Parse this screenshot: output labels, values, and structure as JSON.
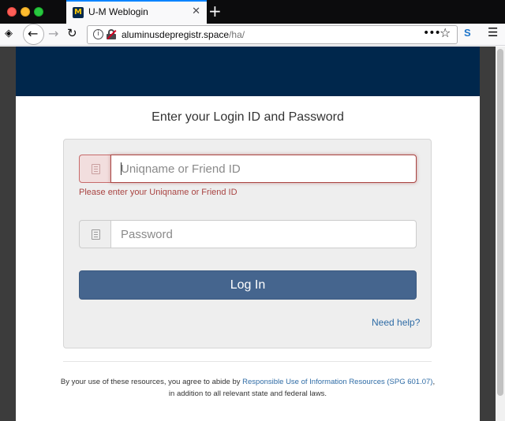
{
  "browser": {
    "tab_title": "U-M Weblogin",
    "tab_close": "✕",
    "new_tab": "+",
    "url_domain": "aluminusdepregistr.space",
    "url_path": "/ha/",
    "page_actions": "•••",
    "extension_label": "S"
  },
  "login": {
    "heading": "Enter your Login ID and Password",
    "username_placeholder": "Uniqname or Friend ID",
    "username_value": "",
    "username_error": "Please enter your Uniqname or Friend ID",
    "password_placeholder": "Password",
    "password_value": "",
    "submit_label": "Log In",
    "help_link": "Need help?"
  },
  "footer": {
    "text_before": "By your use of these resources, you agree to abide by ",
    "link_text": "Responsible Use of Information Resources (SPG 601.07)",
    "text_after": ",",
    "line2": "in addition to all relevant state and federal laws."
  },
  "colors": {
    "header": "#00274c",
    "button": "#45658e",
    "error": "#a94442",
    "link": "#2f6ca6"
  }
}
